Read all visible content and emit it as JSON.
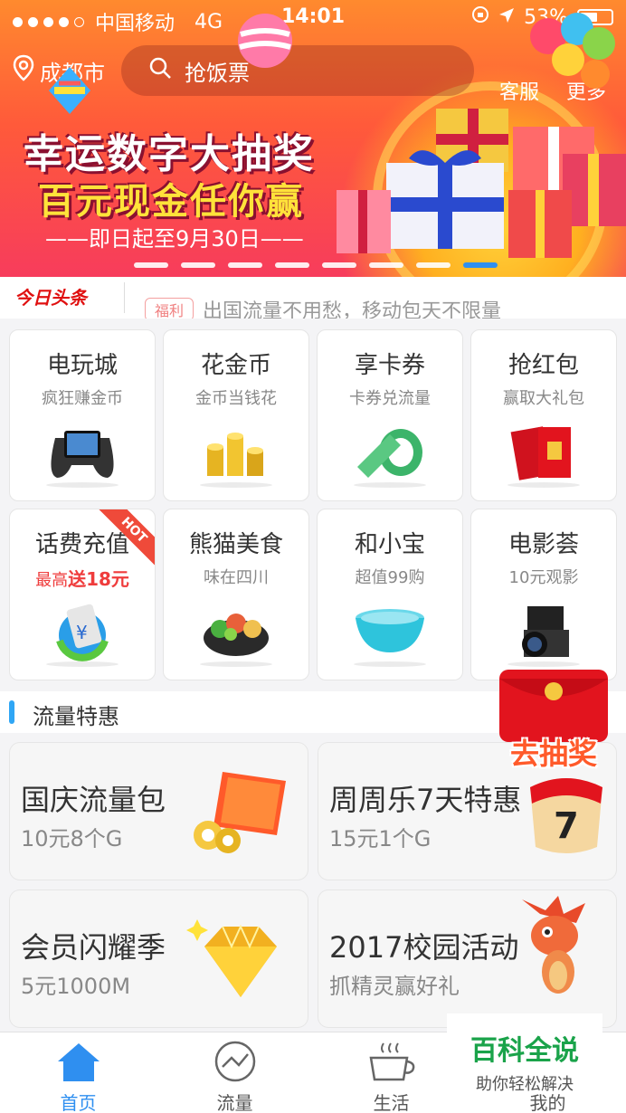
{
  "status_bar": {
    "carrier": "中国移动",
    "network": "4G",
    "time": "14:01",
    "battery": "53%"
  },
  "header": {
    "city": "成都市",
    "search_placeholder": "抢饭票",
    "service": "客服",
    "more": "更多"
  },
  "banner": {
    "title": "幸运数字大抽奖",
    "subtitle": "百元现金任你赢",
    "date": "——即日起至9月30日——",
    "slide_count": 8,
    "active_slide": 8
  },
  "news": {
    "logo": "今日头条",
    "tag": "福利",
    "text": "出国流量不用愁，移动包天不限量"
  },
  "grid": [
    {
      "title": "电玩城",
      "sub": "疯狂赚金币",
      "icon": "gamepad-icon"
    },
    {
      "title": "花金币",
      "sub": "金币当钱花",
      "icon": "gold-coins-icon"
    },
    {
      "title": "享卡券",
      "sub": "卡券兑流量",
      "icon": "ticket-icon"
    },
    {
      "title": "抢红包",
      "sub": "赢取大礼包",
      "icon": "red-envelope-icon"
    },
    {
      "title": "话费充值",
      "sub_prefix": "最高",
      "sub_highlight": "送18元",
      "badge": "HOT",
      "icon": "recharge-icon"
    },
    {
      "title": "熊猫美食",
      "sub": "味在四川",
      "icon": "food-bowl-icon"
    },
    {
      "title": "和小宝",
      "sub": "超值99购",
      "icon": "bowl-icon"
    },
    {
      "title": "电影荟",
      "sub": "10元观影",
      "icon": "camera-icon"
    }
  ],
  "section": {
    "title": "流量特惠"
  },
  "promos": [
    {
      "title": "国庆流量包",
      "sub": "10元8个G",
      "icon": "lantern-icon"
    },
    {
      "title": "周周乐7天特惠",
      "sub": "15元1个G",
      "icon": "calendar-icon",
      "calendar_day": "7"
    },
    {
      "title": "会员闪耀季",
      "sub": "5元1000M",
      "icon": "diamond-icon"
    },
    {
      "title": "2017校园活动",
      "sub": "抓精灵赢好礼",
      "icon": "dragon-icon"
    }
  ],
  "floating": {
    "label": "去抽奖"
  },
  "tabs": [
    {
      "label": "首页",
      "icon": "home-icon",
      "active": true
    },
    {
      "label": "流量",
      "icon": "traffic-icon",
      "active": false
    },
    {
      "label": "生活",
      "icon": "coffee-icon",
      "active": false
    },
    {
      "label": "我的",
      "icon": "user-icon",
      "active": false
    }
  ],
  "watermark": {
    "title": "百科全说",
    "sub": "助你轻松解决"
  },
  "colors": {
    "accent": "#2f8ff0",
    "banner": "#ff5a3a",
    "hot": "#ef4a3a",
    "section_bar": "#2fa6f5"
  }
}
